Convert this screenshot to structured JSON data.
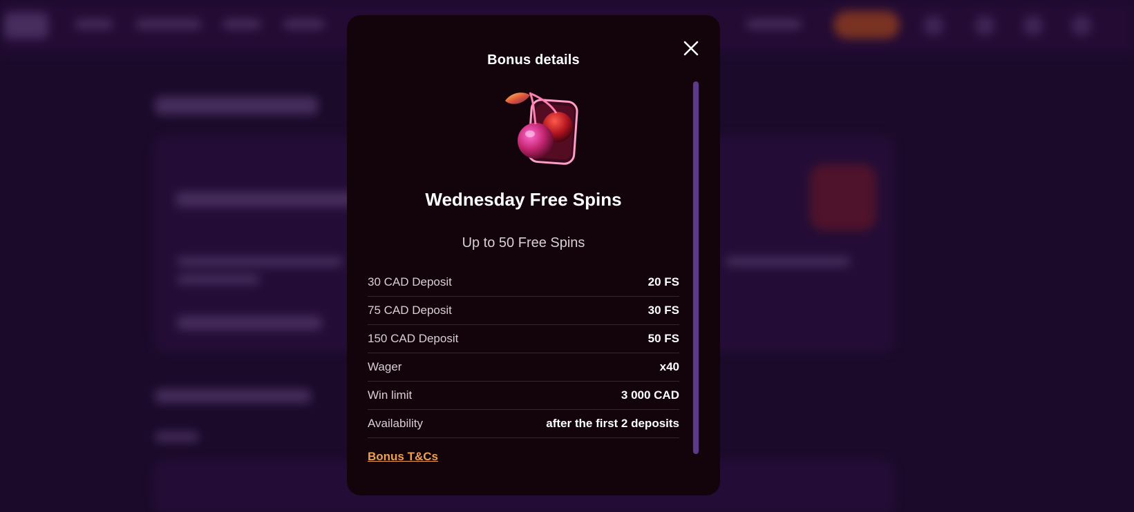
{
  "modal": {
    "title": "Bonus details",
    "close_icon": "close-icon"
  },
  "bonus": {
    "image_icon": "cherry-icon",
    "name": "Wednesday Free Spins",
    "subtitle": "Up to 50 Free Spins",
    "details": [
      {
        "label": "30 CAD Deposit",
        "value": "20 FS"
      },
      {
        "label": "75 CAD Deposit",
        "value": "30 FS"
      },
      {
        "label": "150 CAD Deposit",
        "value": "50 FS"
      },
      {
        "label": "Wager",
        "value": "x40"
      },
      {
        "label": "Win limit",
        "value": "3 000 CAD"
      },
      {
        "label": "Availability",
        "value": "after the first 2 deposits"
      }
    ],
    "terms_link": "Bonus T&Cs"
  },
  "colors": {
    "modal_bg": "#13040c",
    "accent_link": "#f0a04a",
    "scrollbar": "#5c3a8a",
    "page_bg": "#1b0a2a"
  }
}
